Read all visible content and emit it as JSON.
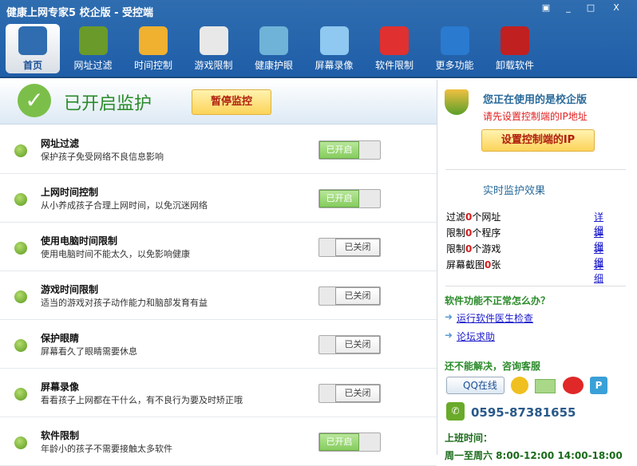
{
  "window": {
    "title": "健康上网专家5 校企版 - 受控端",
    "controls": [
      "▣",
      "_",
      "□",
      "X"
    ]
  },
  "nav": [
    {
      "label": "首页",
      "color": "#2f6db0"
    },
    {
      "label": "网址过滤",
      "color": "#6a9a2a"
    },
    {
      "label": "时间控制",
      "color": "#f0b030"
    },
    {
      "label": "游戏限制",
      "color": "#e8e8e8"
    },
    {
      "label": "健康护眼",
      "color": "#6fb3d8"
    },
    {
      "label": "屏幕录像",
      "color": "#8fc8f0"
    },
    {
      "label": "软件限制",
      "color": "#e03030"
    },
    {
      "label": "更多功能",
      "color": "#2a7ad0"
    },
    {
      "label": "卸载软件",
      "color": "#c02020"
    }
  ],
  "status": {
    "text": "已开启监护",
    "pause_button": "暂停监控"
  },
  "features": [
    {
      "title": "网址过滤",
      "desc": "保护孩子免受网络不良信息影响",
      "on": true,
      "state": "已开启"
    },
    {
      "title": "上网时间控制",
      "desc": "从小养成孩子合理上网时间，以免沉迷网络",
      "on": true,
      "state": "已开启"
    },
    {
      "title": "使用电脑时间限制",
      "desc": "使用电脑时间不能太久，以免影响健康",
      "on": false,
      "state": "已关闭"
    },
    {
      "title": "游戏时间限制",
      "desc": "适当的游戏对孩子动作能力和脑部发育有益",
      "on": false,
      "state": "已关闭"
    },
    {
      "title": "保护眼睛",
      "desc": "屏幕看久了眼睛需要休息",
      "on": false,
      "state": "已关闭"
    },
    {
      "title": "屏幕录像",
      "desc": "看看孩子上网都在干什么，有不良行为要及时矫正哦",
      "on": false,
      "state": "已关闭"
    },
    {
      "title": "软件限制",
      "desc": "年龄小的孩子不需要接触太多软件",
      "on": true,
      "state": "已开启"
    }
  ],
  "side": {
    "edition": "您正在使用的是校企版",
    "warning": "请先设置控制端的IP地址",
    "set_ip_button": "设置控制端的IP",
    "monitor_title": "实时监护效果",
    "stats": [
      {
        "pre": "过滤",
        "n": "0",
        "post": "个网址",
        "link": "详细"
      },
      {
        "pre": "限制",
        "n": "0",
        "post": "个程序",
        "link": "详细"
      },
      {
        "pre": "限制",
        "n": "0",
        "post": "个游戏",
        "link": "详细"
      },
      {
        "pre": "屏幕截图",
        "n": "0",
        "post": "张",
        "link": "详细"
      }
    ],
    "help_title": "软件功能不正常怎么办？",
    "help_links": [
      "运行软件医生检查",
      "论坛求助"
    ],
    "contact_title": "还不能解决，咨询客服",
    "qq": "QQ在线",
    "phone": "0595-87381655",
    "hours_title": "上班时间：",
    "hours": "周一至周六 8:00-12:00 14:00-18:00"
  }
}
